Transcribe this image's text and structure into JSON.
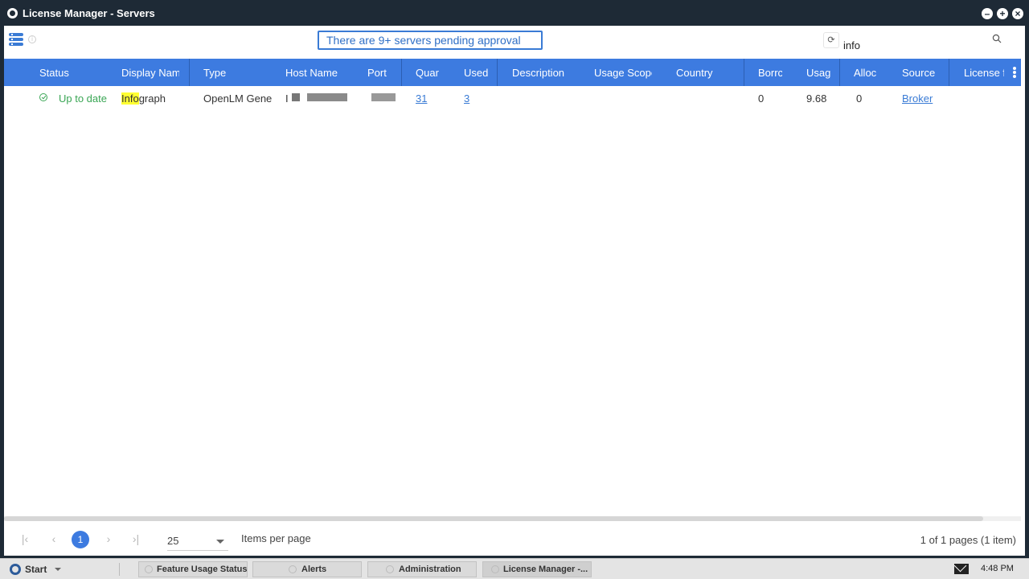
{
  "window": {
    "title": "License Manager - Servers",
    "controls": {
      "minimize": "–",
      "maximize": "+",
      "close": "×"
    }
  },
  "toolbar": {
    "pending_message": "There are 9+ servers pending approval",
    "refresh_icon": "refresh-icon",
    "search_value": "info",
    "search_icon": "search-icon"
  },
  "table": {
    "columns": [
      "Status",
      "Display Nam",
      "Type",
      "Host Name",
      "Port",
      "Quar",
      "Used",
      "Description",
      "Usage Scope",
      "Country",
      "Borrc",
      "Usag",
      "Alloc",
      "Source",
      "License fi"
    ],
    "rows": [
      {
        "status": "Up to date",
        "display_name_highlight": "Info",
        "display_name_rest": "graph",
        "type": "OpenLM Gene",
        "host_prefix": "I",
        "quarantine": "31",
        "used": "3",
        "description": "",
        "usage_scope": "",
        "country": "",
        "borrowed": "0",
        "usage": "9.68",
        "allocated": "0",
        "source": "Broker",
        "license_file": ""
      }
    ]
  },
  "pagination": {
    "first": "|‹",
    "prev": "‹",
    "current_page": "1",
    "next": "›",
    "last": "›|",
    "per_page": "25",
    "per_page_label": "Items per page",
    "summary": "1 of 1 pages (1 item)"
  },
  "taskbar": {
    "start_label": "Start",
    "tasks": [
      {
        "label": "Feature Usage Status"
      },
      {
        "label": "Alerts"
      },
      {
        "label": "Administration"
      },
      {
        "label": "License Manager -..."
      }
    ],
    "clock": "4:48 PM"
  },
  "colors": {
    "header_blue": "#3d7be0",
    "status_green": "#3aa655",
    "highlight": "#ffff33",
    "titlebar": "#1e2a36"
  }
}
